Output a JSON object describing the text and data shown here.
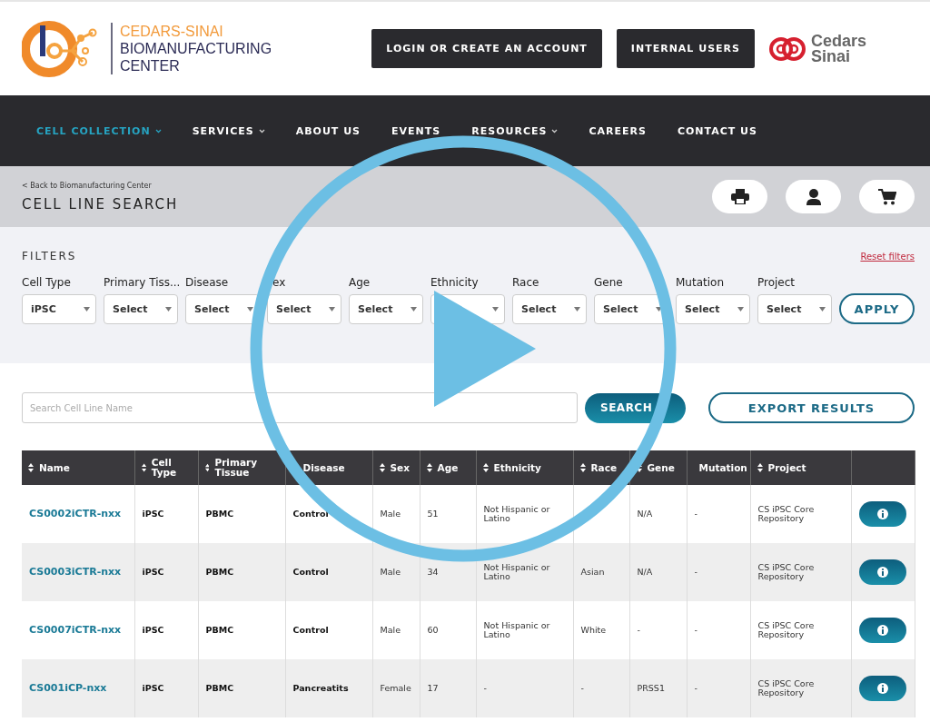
{
  "header": {
    "brand_lines": [
      "CEDARS-SINAI",
      "BIOMANUFACTURING",
      "CENTER"
    ],
    "buttons": [
      "LOGIN OR CREATE AN ACCOUNT",
      "INTERNAL USERS"
    ],
    "partner_logo_lines": [
      "Cedars",
      "Sinai"
    ]
  },
  "nav": [
    {
      "label": "CELL COLLECTION",
      "selected": true,
      "dropdown": true
    },
    {
      "label": "SERVICES",
      "selected": false,
      "dropdown": true
    },
    {
      "label": "ABOUT US",
      "selected": false,
      "dropdown": false
    },
    {
      "label": "EVENTS",
      "selected": false,
      "dropdown": false
    },
    {
      "label": "RESOURCES",
      "selected": false,
      "dropdown": true
    },
    {
      "label": "CAREERS",
      "selected": false,
      "dropdown": false
    },
    {
      "label": "CONTACT US",
      "selected": false,
      "dropdown": false
    }
  ],
  "page": {
    "back_link": "< Back to Biomanufacturing Center",
    "title": "CELL LINE SEARCH"
  },
  "filters": {
    "title": "FILTERS",
    "reset": "Reset filters",
    "apply": "APPLY",
    "fields": [
      {
        "label": "Cell Type",
        "value": "iPSC"
      },
      {
        "label": "Primary Tiss...",
        "value": "Select"
      },
      {
        "label": "Disease",
        "value": "Select"
      },
      {
        "label": "ex",
        "value": "Select"
      },
      {
        "label": "Age",
        "value": "Select"
      },
      {
        "label": "Ethnicity"
      },
      {
        "label": "Race",
        "value": "Select"
      },
      {
        "label": "Gene",
        "value": "Select"
      },
      {
        "label": "Mutation",
        "value": "Select"
      },
      {
        "label": "Project",
        "value": "Select"
      }
    ]
  },
  "search": {
    "placeholder": "Search Cell Line Name",
    "button": "SEARCH",
    "export": "EXPORT RESULTS"
  },
  "table": {
    "columns": [
      "Name",
      "Cell Type",
      "Primary Tissue",
      "Disease",
      "Sex",
      "Age",
      "Ethnicity",
      "Race",
      "Gene",
      "Mutation",
      "Project"
    ],
    "rows": [
      [
        "CS0002iCTR-nxx",
        "iPSC",
        "PBMC",
        "Control",
        "Male",
        "51",
        "Not Hispanic or Latino",
        null,
        "N/A",
        "-",
        "CS iPSC Core Repository"
      ],
      [
        "CS0003iCTR-nxx",
        "iPSC",
        "PBMC",
        "Control",
        "Male",
        "34",
        "Not Hispanic or Latino",
        "Asian",
        "N/A",
        "-",
        "CS iPSC Core Repository"
      ],
      [
        "CS0007iCTR-nxx",
        "iPSC",
        "PBMC",
        "Control",
        "Male",
        "60",
        "Not Hispanic or Latino",
        "White",
        "-",
        "-",
        "CS iPSC Core Repository"
      ],
      [
        "CS001iCP-nxx",
        "iPSC",
        "PBMC",
        "Pancreatits",
        "Female",
        "17",
        "-",
        "-",
        "PRSS1",
        "-",
        "CS iPSC Core Repository"
      ]
    ]
  }
}
